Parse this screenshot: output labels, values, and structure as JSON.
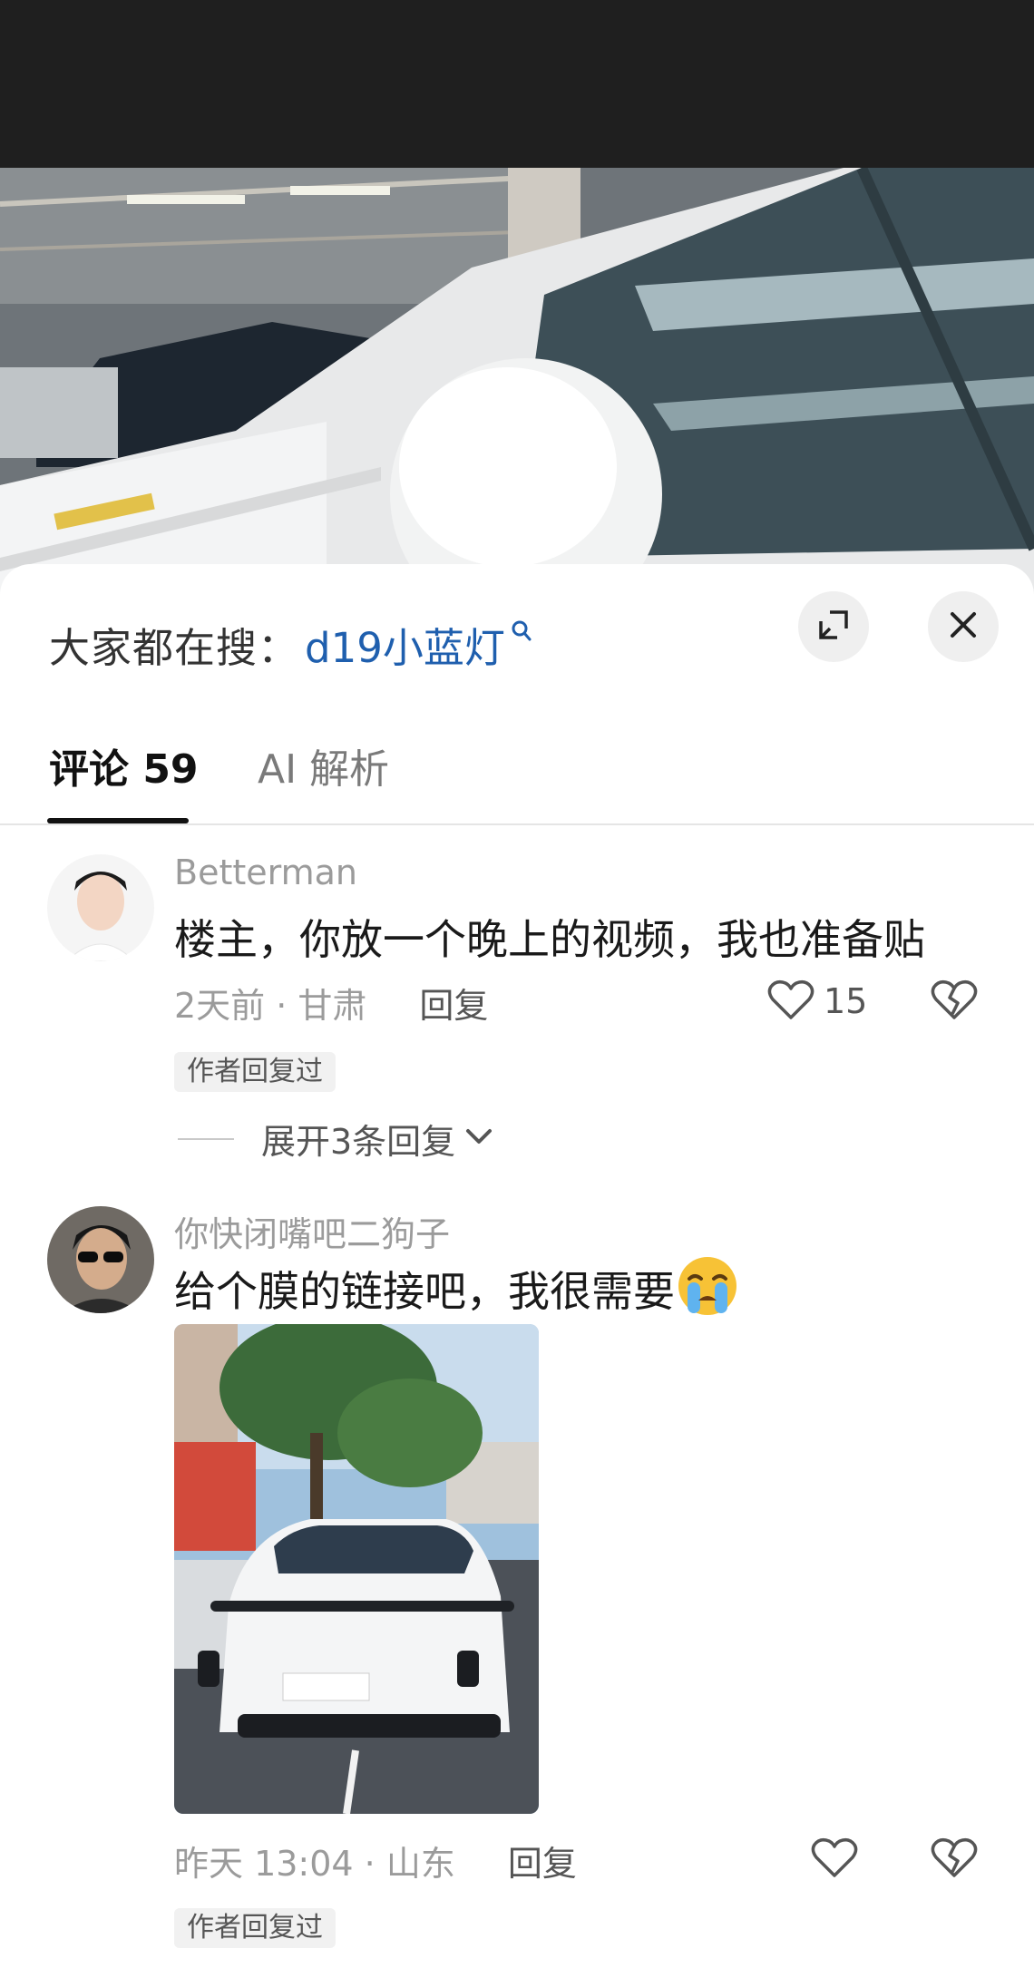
{
  "search": {
    "prefix": "大家都在搜：",
    "term": "d19小蓝灯"
  },
  "tabs": [
    {
      "label": "评论 59",
      "active": true
    },
    {
      "label": "AI 解析",
      "active": false
    }
  ],
  "comments": [
    {
      "username": "Betterman",
      "text": "楼主，你放一个晚上的视频，我也准备贴",
      "meta": "2天前 · 甘肃",
      "reply_label": "回复",
      "like_count": "15",
      "author_replied_badge": "作者回复过",
      "expand_replies": "展开3条回复"
    },
    {
      "username": "你快闭嘴吧二狗子",
      "text": "给个膜的链接吧，我很需要",
      "emoji": "crying-face",
      "meta": "昨天 13:04 · 山东",
      "reply_label": "回复",
      "like_count": "",
      "author_replied_badge": "作者回复过"
    }
  ],
  "colors": {
    "search_term": "#1f5fae",
    "muted_text": "#9b9b9b",
    "primary_text": "#1a1a1a",
    "top_strip": "#1f1f1f"
  },
  "icons": [
    "search-icon",
    "expand-icon",
    "close-icon",
    "heart-icon",
    "broken-heart-icon",
    "chevron-down-icon",
    "crying-face-emoji"
  ]
}
